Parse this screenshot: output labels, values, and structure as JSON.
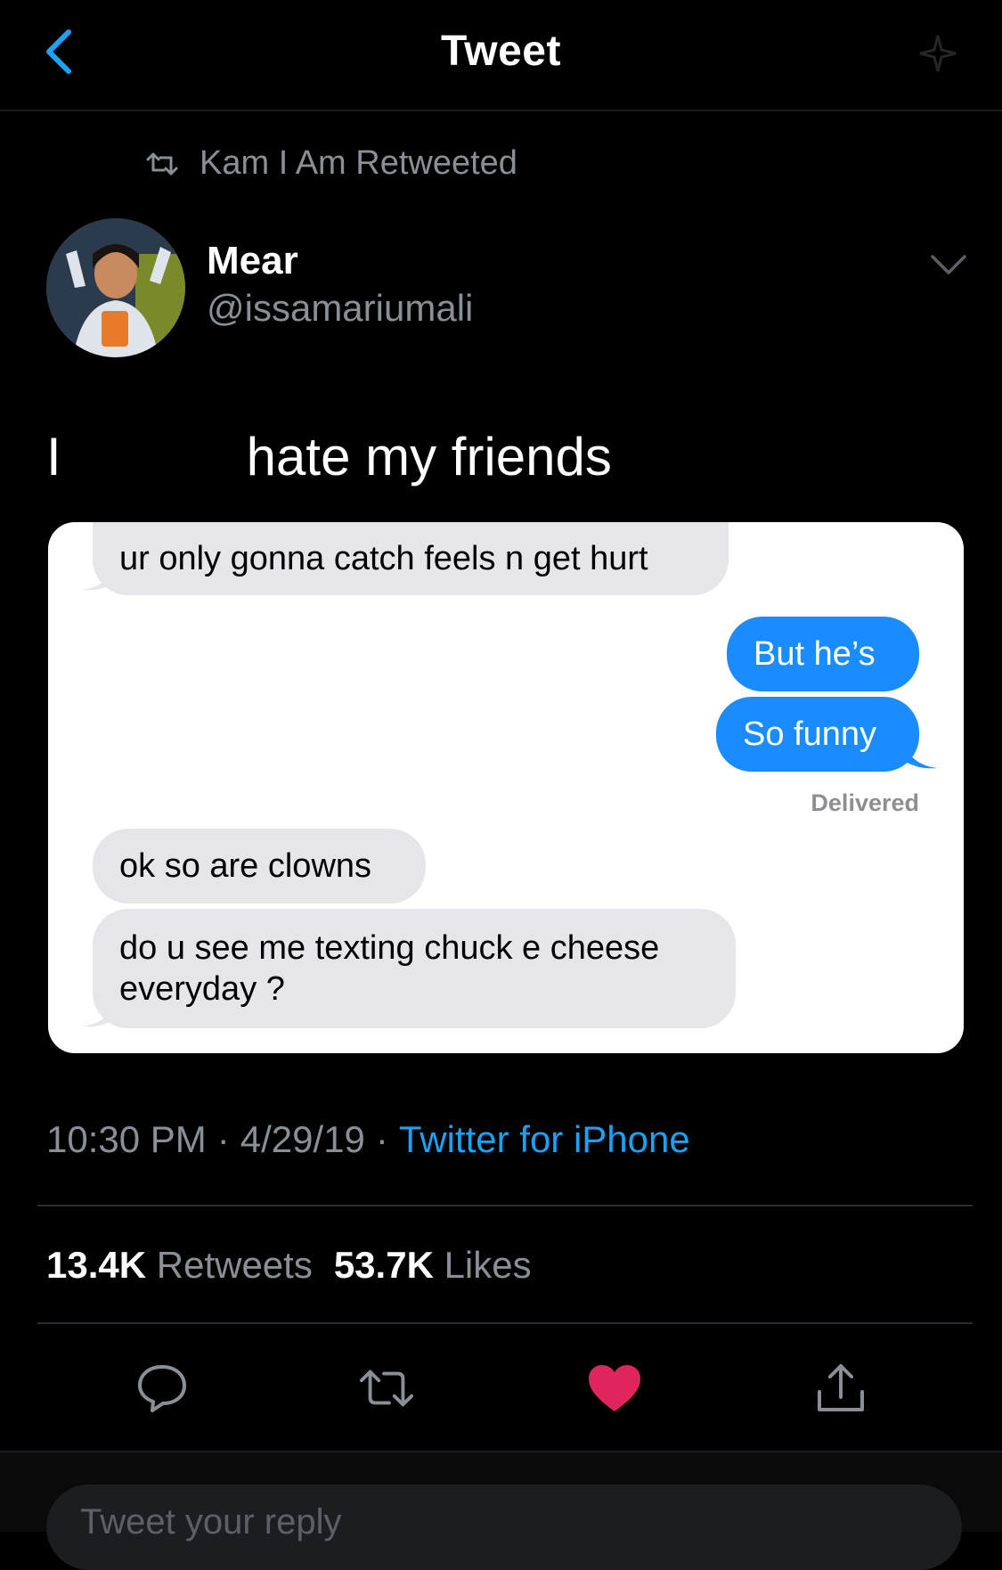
{
  "nav": {
    "title": "Tweet",
    "back_icon": "chevron-left-icon",
    "sparkle_icon": "sparkle-icon"
  },
  "retweet_context": {
    "label": "Kam I Am Retweeted",
    "icon": "retweet-icon"
  },
  "author": {
    "name": "Mear",
    "handle": "@issamariumali",
    "menu_icon": "chevron-down-icon"
  },
  "tweet": {
    "text_word1": "I",
    "text_rest": "hate my friends"
  },
  "messages": {
    "m1": "ur only gonna catch feels n get hurt",
    "m2": "But he’s",
    "m3": "So funny",
    "status": "Delivered",
    "m4": "ok so are clowns",
    "m5_line1": "do u see me texting chuck e cheese",
    "m5_line2": "everyday ?"
  },
  "meta": {
    "time": "10:30 PM",
    "date": "4/29/19",
    "source": "Twitter for iPhone",
    "separator": "·"
  },
  "stats": {
    "retweets_count": "13.4K",
    "retweets_label": "Retweets",
    "likes_count": "53.7K",
    "likes_label": "Likes"
  },
  "actions": {
    "reply_icon": "reply-icon",
    "retweet_icon": "retweet-icon",
    "like_icon": "heart-icon",
    "share_icon": "share-icon"
  },
  "reply": {
    "placeholder": "Tweet your reply"
  },
  "colors": {
    "background": "#000000",
    "secondary_text": "#8a8f96",
    "link": "#1da1f2",
    "imessage_blue": "#1a8cff",
    "imessage_gray": "#e5e5ea",
    "like_red": "#e0245e"
  }
}
